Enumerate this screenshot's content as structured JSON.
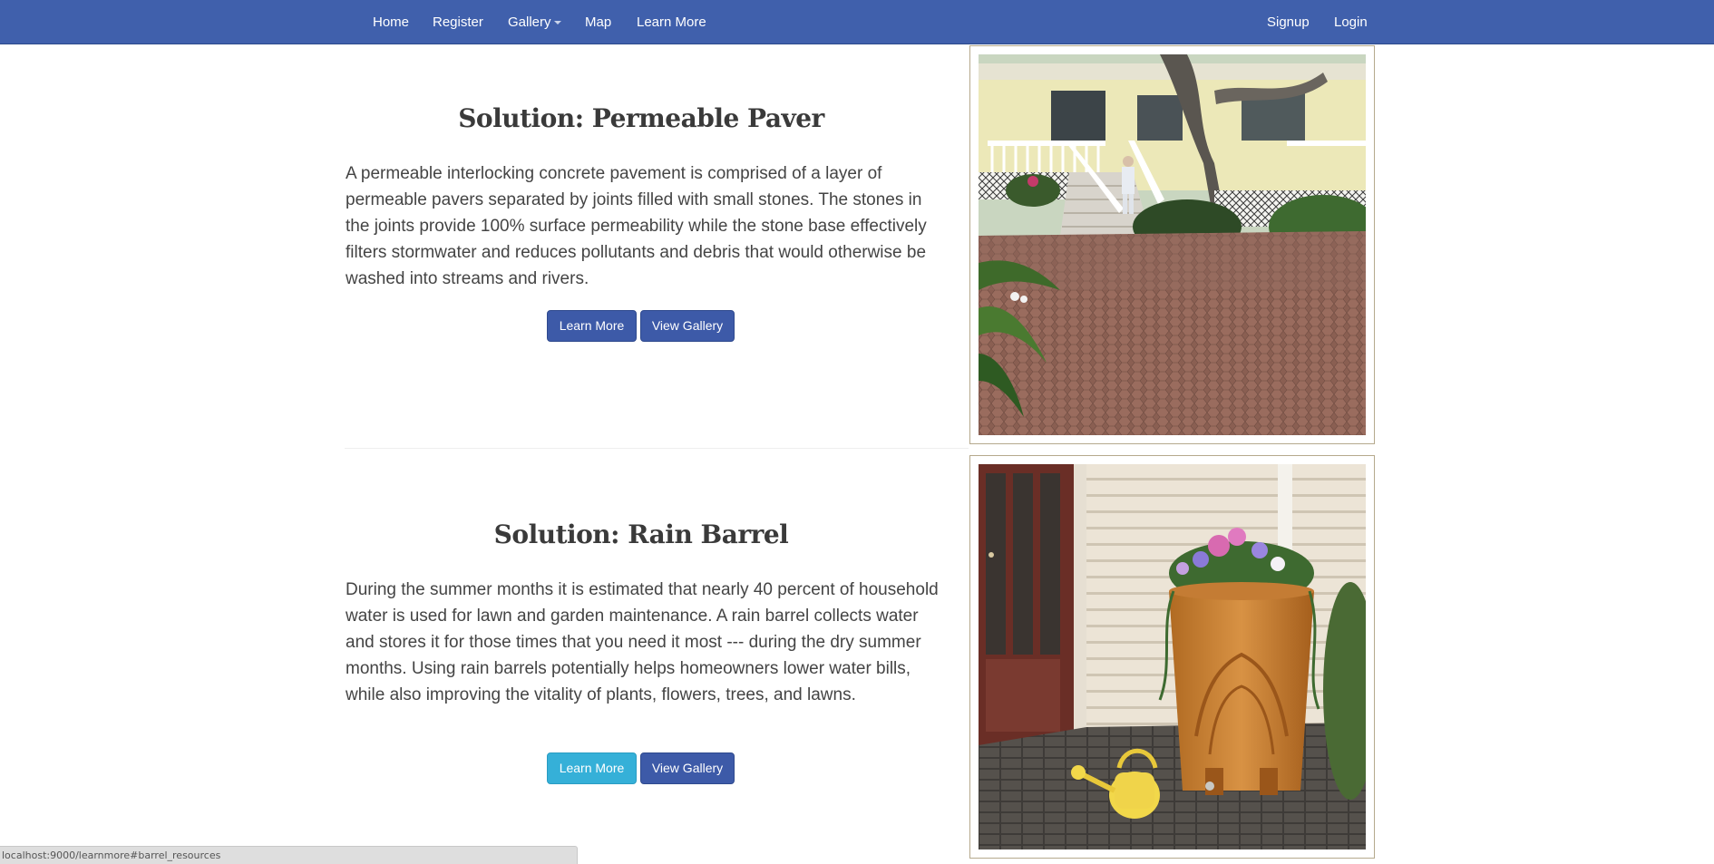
{
  "navbar": {
    "left_items": [
      {
        "label": "Home"
      },
      {
        "label": "Register"
      },
      {
        "label": "Gallery"
      },
      {
        "label": "Map"
      },
      {
        "label": "Learn More"
      }
    ],
    "right_items": [
      {
        "label": "Signup"
      },
      {
        "label": "Login"
      }
    ],
    "background_color": "#4060ac"
  },
  "sections": [
    {
      "title": "Solution: Permeable Paver",
      "text": "A permeable interlocking concrete pavement is comprised of a layer of permeable pavers separated by joints filled with small stones. The stones in the joints provide 100% surface permeability while the stone base effectively filters stormwater and reduces pollutants and debris that would otherwise be washed into streams and rivers.",
      "learn_more_label": "Learn More",
      "view_gallery_label": "View Gallery",
      "image_subject": "house with permeable paver driveway and woman standing on porch steps"
    },
    {
      "title": "Solution: Rain Barrel",
      "text": "During the summer months it is estimated that nearly 40 percent of household water is used for lawn and garden maintenance. A rain barrel collects water and stores it for those times that you need it most --- during the dry summer months. Using rain barrels potentially helps homeowners lower water bills, while also improving the vitality of plants, flowers, trees, and lawns.",
      "learn_more_label": "Learn More",
      "view_gallery_label": "View Gallery",
      "image_subject": "terracotta rain barrel planter with flowers next to house siding and yellow watering can"
    }
  ],
  "statusbar": {
    "url": "localhost:9000/learnmore#barrel_resources"
  },
  "colors": {
    "primary_button": "#3d5aa8",
    "info_button": "#35b0d8",
    "frame_border": "#b5a98c"
  }
}
